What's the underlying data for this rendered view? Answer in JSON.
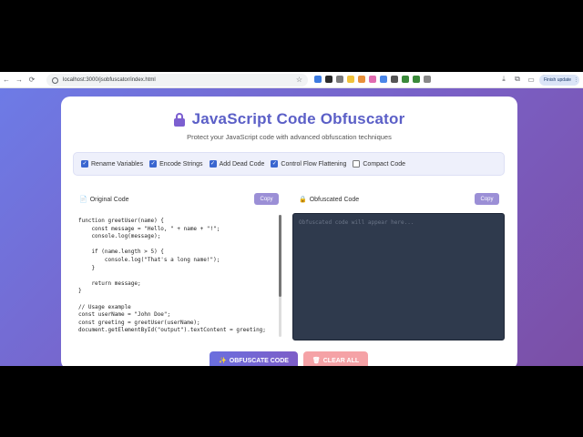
{
  "browser": {
    "url": "localhost:3000/jsobfuscator/index.html",
    "finish_update_label": "Finish update",
    "extension_colors": [
      "#3d7be0",
      "#2b2b2b",
      "#7a7a7a",
      "#f0c23a",
      "#e8903a",
      "#e06bb0",
      "#4a86e8",
      "#555555",
      "#3a8a3a",
      "#3a8a3a",
      "#888888"
    ]
  },
  "header": {
    "title": "JavaScript Code Obfuscator",
    "subtitle": "Protect your JavaScript code with advanced obfuscation techniques"
  },
  "options": [
    {
      "label": "Rename Variables",
      "checked": true
    },
    {
      "label": "Encode Strings",
      "checked": true
    },
    {
      "label": "Add Dead Code",
      "checked": true
    },
    {
      "label": "Control Flow Flattening",
      "checked": true
    },
    {
      "label": "Compact Code",
      "checked": false
    }
  ],
  "original_panel": {
    "label": "Original Code",
    "copy_label": "Copy",
    "code": "function greetUser(name) {\n    const message = \"Hello, \" + name + \"!\";\n    console.log(message);\n\n    if (name.length > 5) {\n        console.log(\"That's a long name!\");\n    }\n\n    return message;\n}\n\n// Usage example\nconst userName = \"John Doe\";\nconst greeting = greetUser(userName);\ndocument.getElementById(\"output\").textContent = greeting;"
  },
  "output_panel": {
    "label": "Obfuscated Code",
    "copy_label": "Copy",
    "placeholder": "Obfuscated code will appear here..."
  },
  "actions": {
    "obfuscate_label": "OBFUSCATE CODE",
    "clear_label": "CLEAR ALL"
  },
  "colors": {
    "accent": "#5b5fc7",
    "output_bg": "#2f3a4d",
    "clear_bg": "#f5a2a6"
  }
}
